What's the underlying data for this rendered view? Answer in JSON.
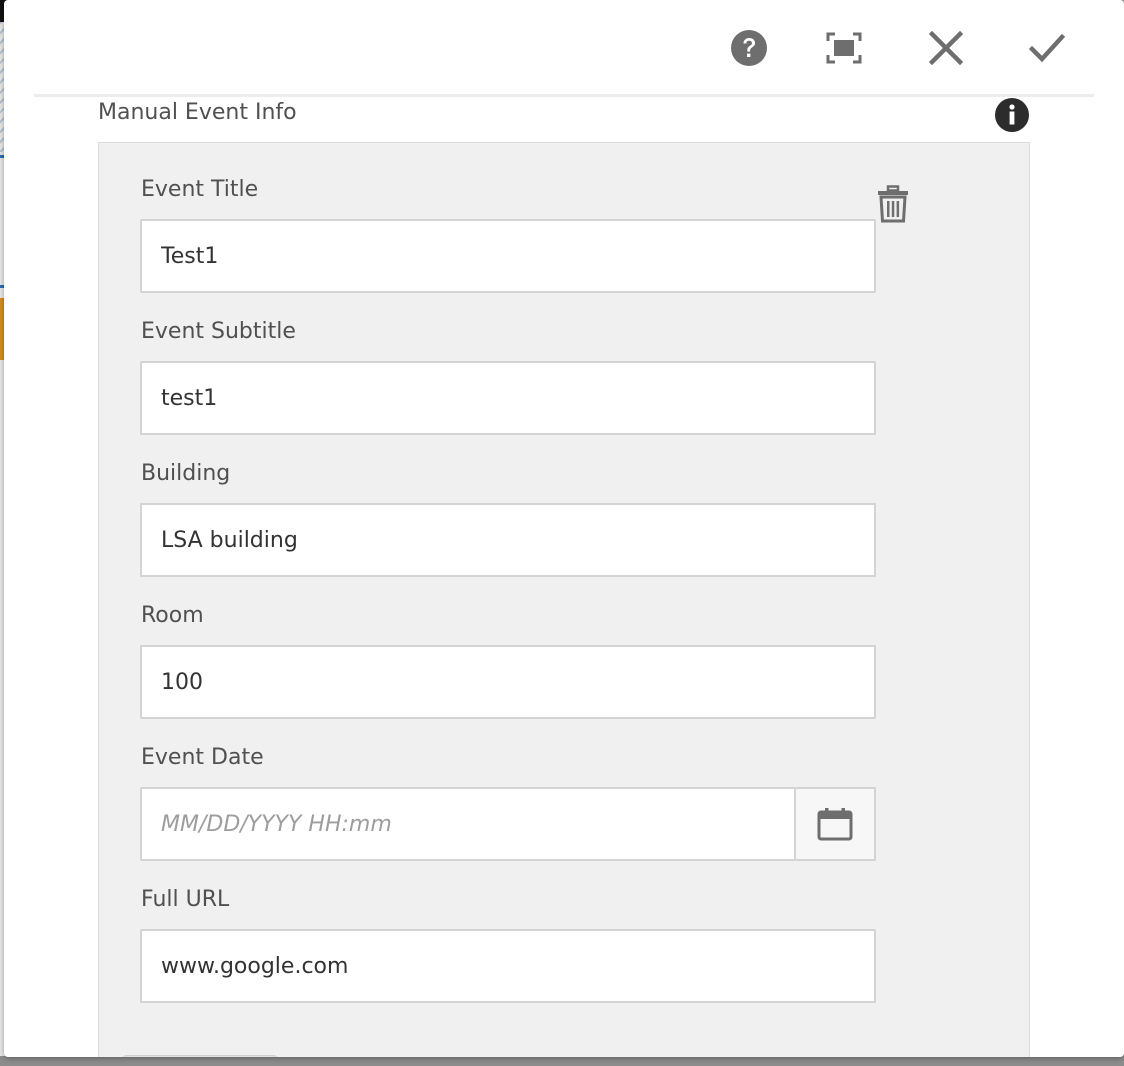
{
  "toolbar": {
    "help_icon": "help-circle-icon",
    "fullscreen_icon": "fullscreen-icon",
    "close_icon": "close-icon",
    "confirm_icon": "checkmark-icon"
  },
  "section": {
    "title": "Manual Event Info",
    "info_icon": "info-circle-icon"
  },
  "form": {
    "delete_icon": "trash-icon",
    "fields": {
      "event_title": {
        "label": "Event Title",
        "value": "Test1"
      },
      "event_subtitle": {
        "label": "Event Subtitle",
        "value": "test1"
      },
      "building": {
        "label": "Building",
        "value": "LSA building"
      },
      "room": {
        "label": "Room",
        "value": "100"
      },
      "event_date": {
        "label": "Event Date",
        "value": "",
        "placeholder": "MM/DD/YYYY HH:mm",
        "icon": "calendar-icon"
      },
      "full_url": {
        "label": "Full URL",
        "value": "www.google.com"
      }
    }
  },
  "colors": {
    "icon": "#6e6e6e",
    "info_icon": "#2c2c2c",
    "panel_bg": "#f0f0f0",
    "border": "#d4d4d4"
  }
}
